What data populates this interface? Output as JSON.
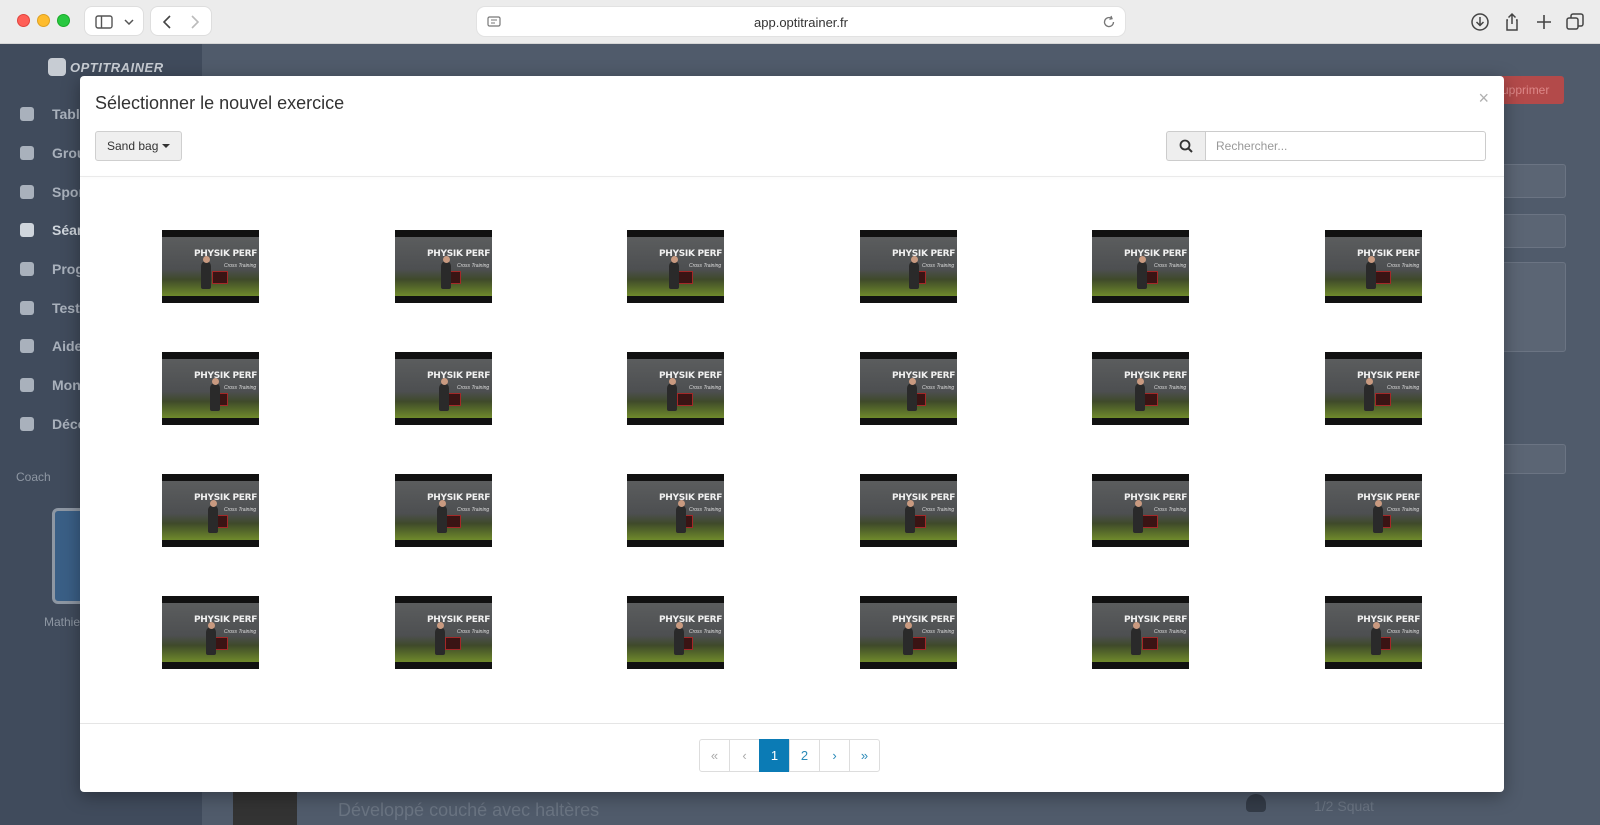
{
  "browser": {
    "url": "app.optitrainer.fr"
  },
  "app": {
    "brand": "OPTITRAINER",
    "sidebar_items": [
      {
        "label": "Tableau de bord",
        "icon": "dashboard-icon"
      },
      {
        "label": "Groupes",
        "icon": "group-icon"
      },
      {
        "label": "Sportifs",
        "icon": "user-icon"
      },
      {
        "label": "Séances",
        "icon": "database-icon"
      },
      {
        "label": "Programmes",
        "icon": "program-icon"
      },
      {
        "label": "Tests",
        "icon": "chart-icon"
      },
      {
        "label": "Aide",
        "icon": "help-icon"
      },
      {
        "label": "Mon compte",
        "icon": "gear-icon"
      },
      {
        "label": "Déconnexion",
        "icon": "logout-icon"
      }
    ],
    "coach_label": "Coach",
    "user_name": "Mathieu",
    "delete_button": "Supprimer",
    "bottom_exercise": "Développé couché avec haltères",
    "bottom_right_text": "1/2 Squat"
  },
  "modal": {
    "title": "Sélectionner le nouvel exercice",
    "close": "×",
    "filter_label": "Sand bag",
    "search_placeholder": "Rechercher...",
    "thumbnail_logo": "PHYSIK PERF",
    "thumbnail_sub": "Cross Training",
    "thumbnail_count": 24,
    "pagination": {
      "first": "«",
      "prev": "‹",
      "pages": [
        "1",
        "2"
      ],
      "active_page": "1",
      "next": "›",
      "last": "»"
    }
  }
}
